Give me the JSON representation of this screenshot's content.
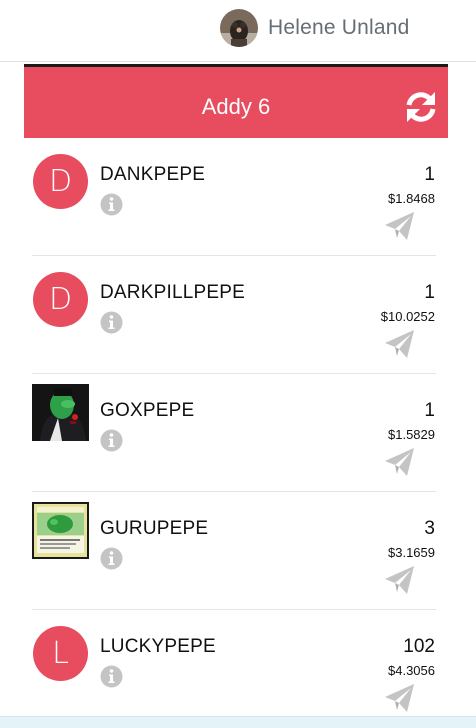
{
  "user": {
    "name": "Helene Unland",
    "avatar_icon": "user-avatar-photo"
  },
  "wallet": {
    "title": "Addy 6",
    "refresh_icon": "refresh-icon",
    "accent_color": "#e84c5f"
  },
  "assets": [
    {
      "name": "DANKPEPE",
      "quantity": "1",
      "value": "$1.8468",
      "icon_type": "letter",
      "icon_letter": "D"
    },
    {
      "name": "DARKPILLPEPE",
      "quantity": "1",
      "value": "$10.0252",
      "icon_type": "letter",
      "icon_letter": "D"
    },
    {
      "name": "GOXPEPE",
      "quantity": "1",
      "value": "$1.5829",
      "icon_type": "image",
      "icon_name": "goxpepe-card-image"
    },
    {
      "name": "GURUPEPE",
      "quantity": "3",
      "value": "$3.1659",
      "icon_type": "image",
      "icon_name": "gurupepe-card-image"
    },
    {
      "name": "LUCKYPEPE",
      "quantity": "102",
      "value": "$4.3056",
      "icon_type": "letter",
      "icon_letter": "L"
    }
  ]
}
